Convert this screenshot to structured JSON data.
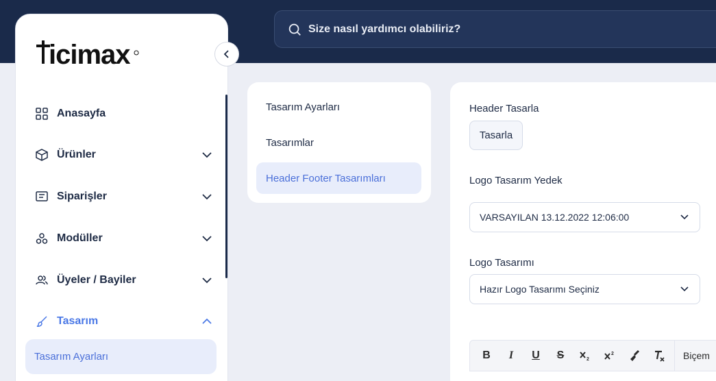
{
  "search": {
    "placeholder": "Size nasıl yardımcı olabiliriz?"
  },
  "brand": {
    "logo_text": "ticimax",
    "accent": "#4a78e6",
    "navy": "#1a2a4a"
  },
  "sidebar": {
    "items": [
      {
        "label": "Anasayfa",
        "icon": "grid-icon"
      },
      {
        "label": "Ürünler",
        "icon": "box-icon"
      },
      {
        "label": "Siparişler",
        "icon": "receipt-icon"
      },
      {
        "label": "Modüller",
        "icon": "modules-icon"
      },
      {
        "label": "Üyeler / Bayiler",
        "icon": "users-icon"
      },
      {
        "label": "Tasarım",
        "icon": "brush-icon"
      }
    ],
    "active_sub": "Tasarım Ayarları"
  },
  "submenu": {
    "items": [
      "Tasarım Ayarları",
      "Tasarımlar",
      "Header Footer Tasarımları"
    ],
    "active_index": 2
  },
  "content": {
    "header_label": "Header Tasarla",
    "header_button": "Tasarla",
    "logo_backup_label": "Logo Tasarım Yedek",
    "logo_backup_value": "VARSAYILAN 13.12.2022 12:06:00",
    "logo_design_label": "Logo Tasarımı",
    "logo_design_value": "Hazır Logo Tasarımı Seçiniz"
  },
  "editor": {
    "tools": [
      "bold",
      "italic",
      "underline",
      "strikethrough",
      "subscript",
      "superscript",
      "format-painter",
      "clear-format"
    ],
    "bold": "B",
    "italic": "I",
    "underline": "U",
    "strike": "S",
    "format_label": "Biçem"
  }
}
